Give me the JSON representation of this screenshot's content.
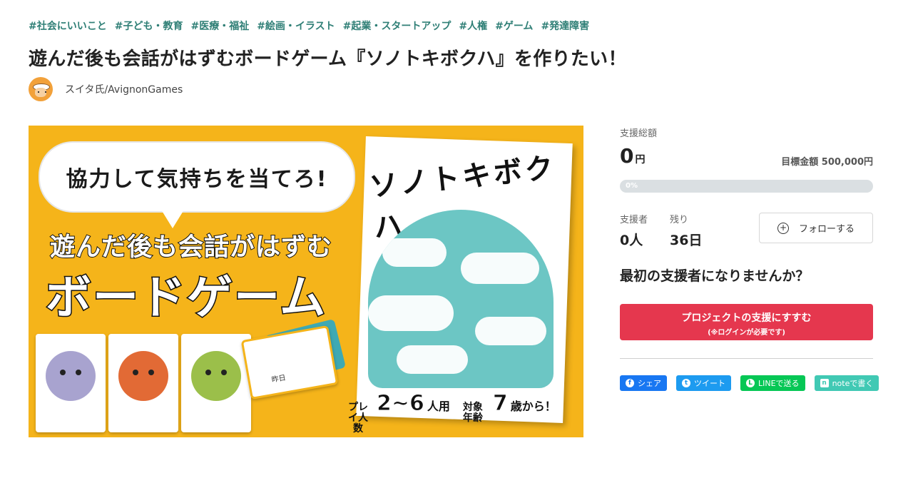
{
  "tags": [
    "#社会にいいこと",
    "#子ども・教育",
    "#医療・福祉",
    "#絵画・イラスト",
    "#起業・スタートアップ",
    "#人権",
    "#ゲーム",
    "#発達障害"
  ],
  "title": "遊んだ後も会話がはずむボードゲーム『ソノトキボクハ』を作りたい！",
  "owner": {
    "name": "スイタ氏/AvignonGames"
  },
  "hero": {
    "bubble_text": "協力して気持ちを当てろ!",
    "subtitle": "遊んだ後も会話がはずむ",
    "headline": "ボードゲーム",
    "box_title": "ソノトキボクハ",
    "card_label": "昨日",
    "players_label": "プレイ人数",
    "players_value": "2~6",
    "players_unit": "人用",
    "age_label": "対象年齢",
    "age_value": "7",
    "age_unit": "歳から！"
  },
  "panel": {
    "raised_label": "支援総額",
    "raised_value": "0",
    "raised_unit": "円",
    "goal": "目標金額 500,000円",
    "progress_percent": 0,
    "progress_text": "0%",
    "backers_label": "支援者",
    "backers_value": "0人",
    "remaining_label": "残り",
    "remaining_value": "36日",
    "follow_label": "フォローする",
    "first_backer_prompt": "最初の支援者になりませんか？",
    "support_button_line1": "プロジェクトの支援にすすむ",
    "support_button_line2": "(※ログインが必要です)"
  },
  "share": [
    {
      "label": "シェア",
      "color": "#1877f2",
      "icon": "facebook-icon"
    },
    {
      "label": "ツイート",
      "color": "#1d9bf0",
      "icon": "twitter-icon"
    },
    {
      "label": "LINEで送る",
      "color": "#06c755",
      "icon": "line-icon"
    },
    {
      "label": "noteで書く",
      "color": "#41c9b4",
      "icon": "note-icon"
    }
  ],
  "colors": {
    "accent": "#2f7f76",
    "support_button": "#e5374e",
    "hero_bg": "#f5b41a"
  }
}
